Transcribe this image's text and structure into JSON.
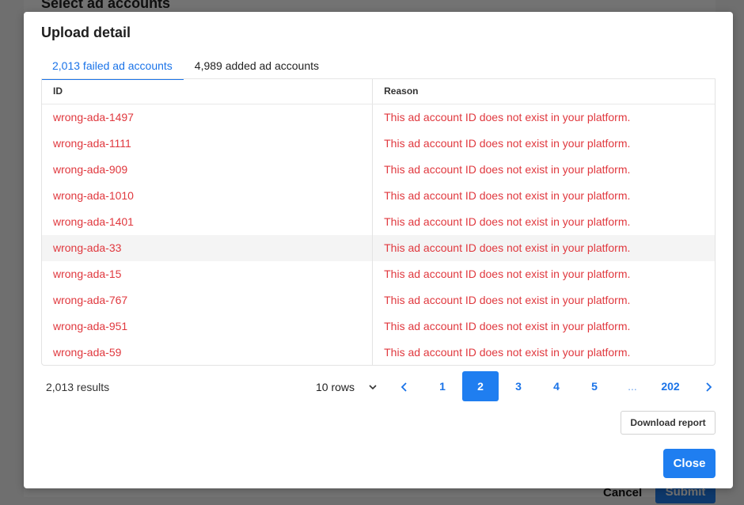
{
  "background": {
    "title": "Select ad accounts",
    "cancel_label": "Cancel",
    "submit_label": "Submit"
  },
  "modal": {
    "title": "Upload detail",
    "tabs": [
      {
        "label": "2,013 failed ad accounts",
        "active": true
      },
      {
        "label": "4,989 added ad accounts",
        "active": false
      }
    ],
    "table": {
      "columns": [
        "ID",
        "Reason"
      ],
      "rows": [
        {
          "id": "wrong-ada-1497",
          "reason": "This ad account ID does not exist in your platform."
        },
        {
          "id": "wrong-ada-1111",
          "reason": "This ad account ID does not exist in your platform."
        },
        {
          "id": "wrong-ada-909",
          "reason": "This ad account ID does not exist in your platform."
        },
        {
          "id": "wrong-ada-1010",
          "reason": "This ad account ID does not exist in your platform."
        },
        {
          "id": "wrong-ada-1401",
          "reason": "This ad account ID does not exist in your platform."
        },
        {
          "id": "wrong-ada-33",
          "reason": "This ad account ID does not exist in your platform."
        },
        {
          "id": "wrong-ada-15",
          "reason": "This ad account ID does not exist in your platform."
        },
        {
          "id": "wrong-ada-767",
          "reason": "This ad account ID does not exist in your platform."
        },
        {
          "id": "wrong-ada-951",
          "reason": "This ad account ID does not exist in your platform."
        },
        {
          "id": "wrong-ada-59",
          "reason": "This ad account ID does not exist in your platform."
        }
      ]
    },
    "footer": {
      "results": "2,013 results",
      "rows_per_page": "10 rows",
      "pages": [
        "1",
        "2",
        "3",
        "4",
        "5",
        "...",
        "202"
      ],
      "current_page": "2"
    },
    "download_label": "Download report",
    "close_label": "Close"
  },
  "colors": {
    "accent": "#1f7ef0",
    "error_text": "#e0383e"
  }
}
